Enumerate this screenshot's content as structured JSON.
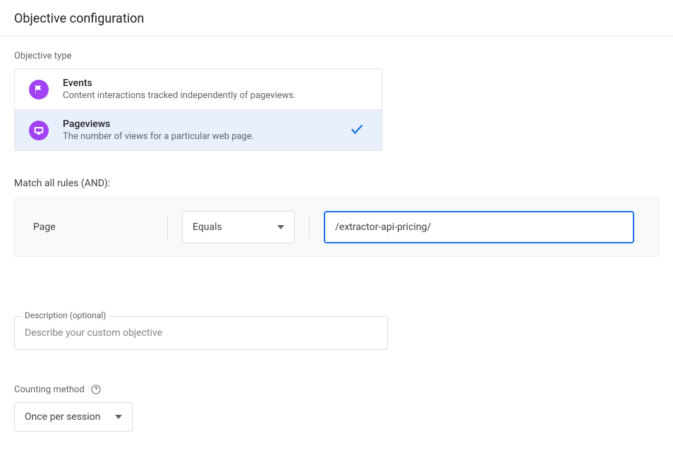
{
  "page_title": "Objective configuration",
  "objective_type_label": "Objective type",
  "options": [
    {
      "title": "Events",
      "desc": "Content interactions tracked independently of pageviews.",
      "selected": false,
      "icon": "flag"
    },
    {
      "title": "Pageviews",
      "desc": "The number of views for a particular web page.",
      "selected": true,
      "icon": "display"
    }
  ],
  "rules_label": "Match all rules (AND):",
  "rule": {
    "field": "Page",
    "operator": "Equals",
    "value": "/extractor-api-pricing/"
  },
  "description": {
    "label": "Description (optional)",
    "placeholder": "Describe your custom objective",
    "value": ""
  },
  "counting": {
    "label": "Counting method",
    "value": "Once per session"
  }
}
